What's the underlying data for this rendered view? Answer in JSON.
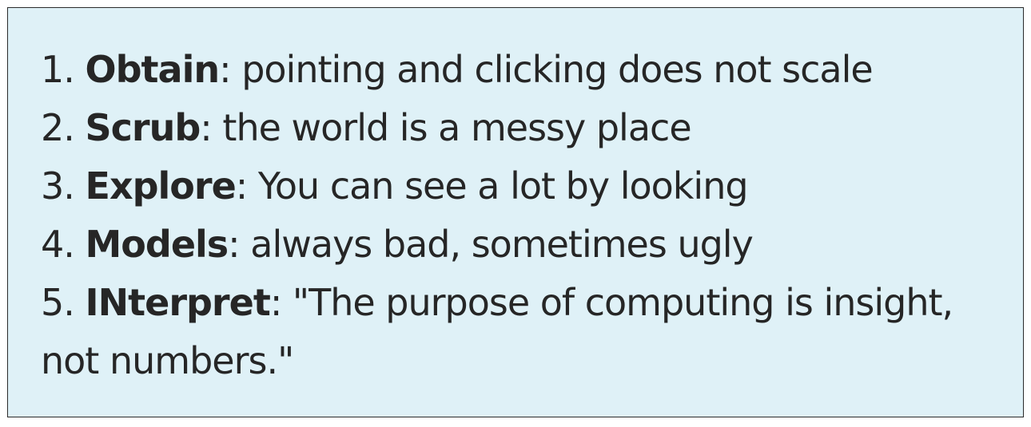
{
  "steps": [
    {
      "number": "1.",
      "term": "Obtain",
      "separator": ":",
      "description": " pointing and clicking does not scale"
    },
    {
      "number": "2.",
      "term": "Scrub",
      "separator": ":",
      "description": " the world is a messy place"
    },
    {
      "number": "3.",
      "term": "Explore",
      "separator": ":",
      "description": " You can see a lot by looking"
    },
    {
      "number": "4.",
      "term": "Models",
      "separator": ":",
      "description": " always bad, sometimes ugly"
    },
    {
      "number": "5.",
      "term": "INterpret",
      "separator": ":",
      "description": " \"The purpose of computing is insight, not numbers.\""
    }
  ],
  "colors": {
    "box_background": "#dff1f7",
    "box_border": "#2b2b2b",
    "text": "#262626"
  }
}
